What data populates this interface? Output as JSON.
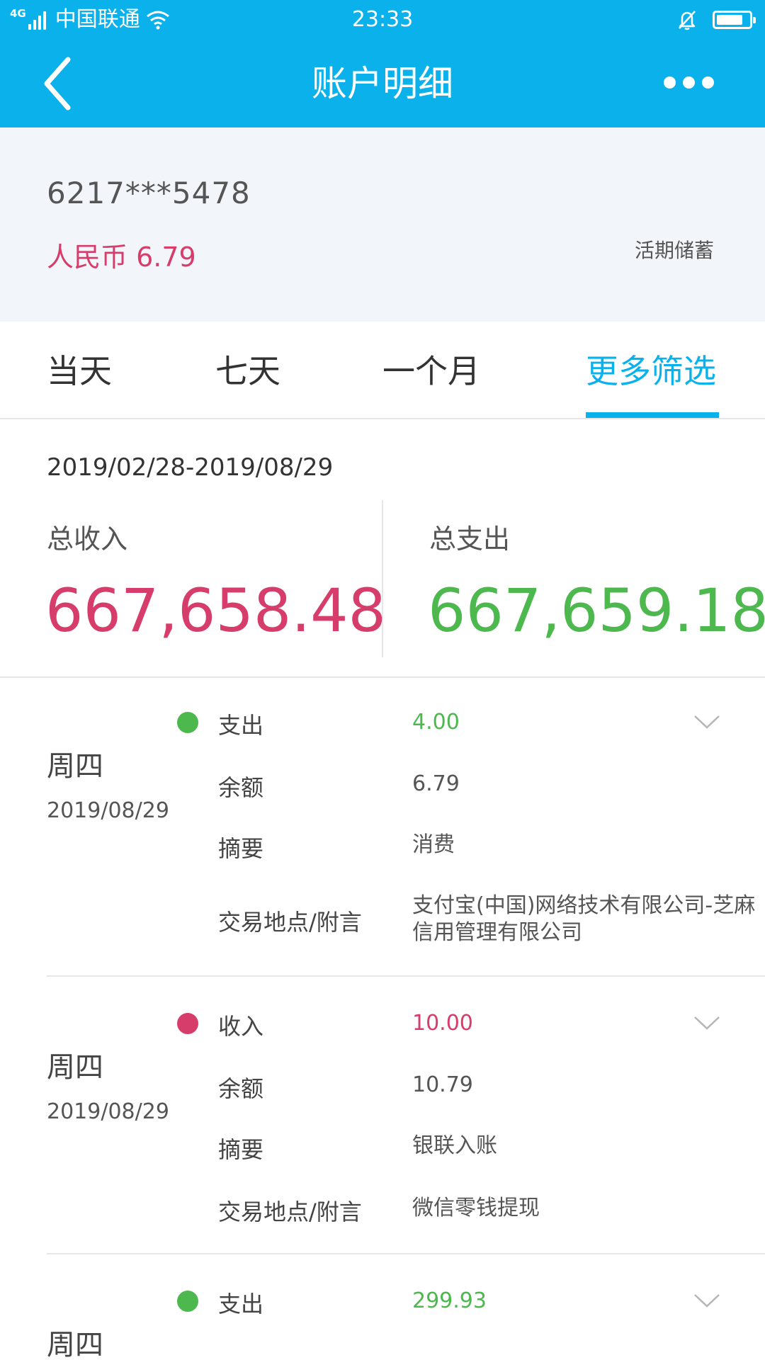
{
  "status_bar": {
    "network": "4G",
    "carrier": "中国联通",
    "time": "23:33",
    "icons": [
      "signal-icon",
      "wifi-icon",
      "bell-off-icon",
      "battery-icon"
    ]
  },
  "nav": {
    "title": "账户明细",
    "back_icon": "chevron-left-icon",
    "more_icon": "more-dots-icon"
  },
  "account": {
    "number": "6217***5478",
    "balance": "人民币 6.79",
    "type": "活期储蓄"
  },
  "tabs": [
    {
      "label": "当天",
      "active": false
    },
    {
      "label": "七天",
      "active": false
    },
    {
      "label": "一个月",
      "active": false
    },
    {
      "label": "更多筛选",
      "active": true
    }
  ],
  "summary": {
    "range": "2019/02/28-2019/08/29",
    "income_label": "总收入",
    "income_value": "667,658.48",
    "expense_label": "总支出",
    "expense_value": "667,659.18"
  },
  "labels": {
    "balance": "余额",
    "summary": "摘要",
    "location": "交易地点/附言"
  },
  "transactions": [
    {
      "weekday": "周四",
      "date": "2019/08/29",
      "kind": "支出",
      "amount": "4.00",
      "balance": "6.79",
      "summary": "消费",
      "location": "支付宝(中国)网络技术有限公司-芝麻信用管理有限公司"
    },
    {
      "weekday": "周四",
      "date": "2019/08/29",
      "kind": "收入",
      "amount": "10.00",
      "balance": "10.79",
      "summary": "银联入账",
      "location": "微信零钱提现"
    },
    {
      "weekday": "周四",
      "kind": "支出",
      "amount": "299.93"
    }
  ],
  "colors": {
    "brand": "#0bb1ea",
    "income": "#d63d6a",
    "expense": "#4db84e"
  }
}
